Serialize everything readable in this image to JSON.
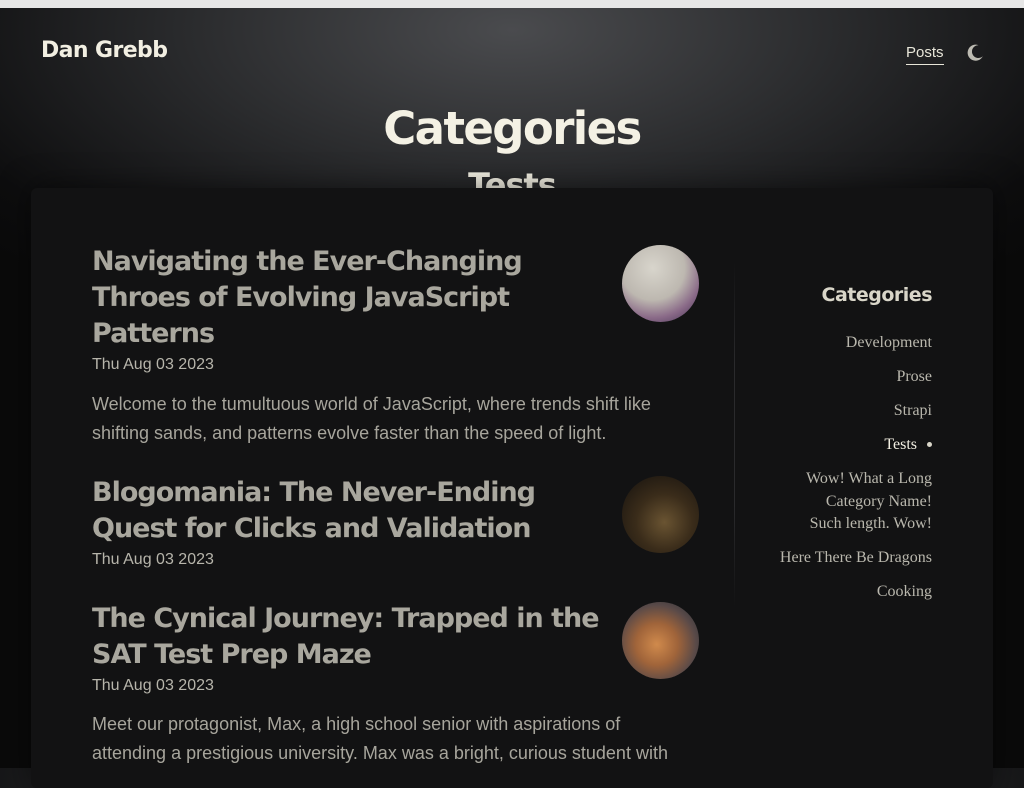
{
  "site": {
    "title": "Dan Grebb"
  },
  "nav": {
    "posts_label": "Posts",
    "theme_toggle_icon": "moon-icon"
  },
  "page": {
    "title": "Categories",
    "subtitle": "Tests"
  },
  "posts": [
    {
      "title": "Navigating the Ever-Changing Throes of Evolving JavaScript Patterns",
      "date": "Thu Aug 03 2023",
      "excerpt": "Welcome to the tumultuous world of JavaScript, where trends shift like shifting sands, and patterns evolve faster than the speed of light."
    },
    {
      "title": "Blogomania: The Never-Ending Quest for Clicks and Validation",
      "date": "Thu Aug 03 2023",
      "excerpt": ""
    },
    {
      "title": "The Cynical Journey: Trapped in the SAT Test Prep Maze",
      "date": "Thu Aug 03 2023",
      "excerpt": "Meet our protagonist, Max, a high school senior with aspirations of attending a prestigious university. Max was a bright, curious student with"
    }
  ],
  "sidebar": {
    "heading": "Categories",
    "items": [
      {
        "label": "Development"
      },
      {
        "label": "Prose"
      },
      {
        "label": "Strapi"
      },
      {
        "label": "Tests",
        "active": true
      },
      {
        "label": "Wow! What a Long Category Name! Such length. Wow!"
      },
      {
        "label": "Here There Be Dragons"
      },
      {
        "label": "Cooking"
      }
    ]
  }
}
